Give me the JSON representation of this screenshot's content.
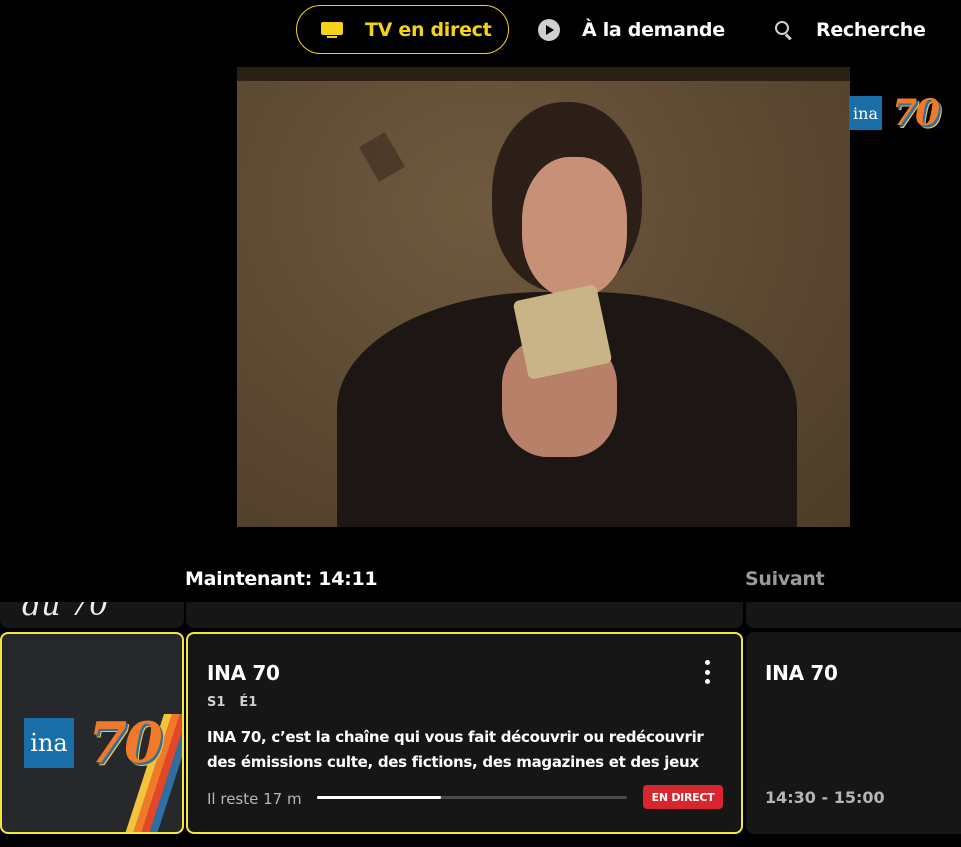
{
  "nav": {
    "live_label": "TV en direct",
    "vod_label": "À la demande",
    "search_label": "Recherche"
  },
  "player": {
    "channel_logo": {
      "ina": "ina",
      "number": "70"
    }
  },
  "guide": {
    "now_heading": "Maintenant: 14:11",
    "next_heading": "Suivant",
    "channel_logo": {
      "ina": "ina",
      "number": "70"
    },
    "now_program": {
      "title": "INA 70",
      "season": "S1",
      "episode": "É1",
      "description": "INA 70, c’est la chaîne qui vous fait découvrir ou redécouvrir des émissions culte, des fictions, des magazines et des jeux qui ont…",
      "remaining": "Il reste 17 m",
      "progress_percent": 40,
      "live_badge": "EN DIRECT"
    },
    "next_program": {
      "title": "INA 70",
      "time": "14:30 - 15:00"
    }
  },
  "colors": {
    "accent": "#f5d21a",
    "focus_border": "#f5e63c",
    "live_badge": "#d7262e"
  }
}
